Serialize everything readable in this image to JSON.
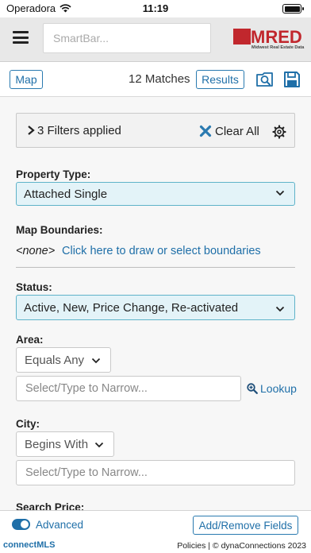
{
  "status_bar": {
    "carrier": "Operadora",
    "time": "11:19"
  },
  "header": {
    "search_placeholder": "SmartBar...",
    "logo_word": "MRED",
    "logo_tagline": "Midwest Real Estate Data"
  },
  "toolbar": {
    "map_label": "Map",
    "matches_text": "12 Matches",
    "results_label": "Results"
  },
  "filters": {
    "summary": "3 Filters applied",
    "clear_label": "Clear All"
  },
  "property_type": {
    "label": "Property Type:",
    "value": "Attached Single"
  },
  "map_boundaries": {
    "label": "Map Boundaries:",
    "none_text": "<none>",
    "link_text": "Click here to draw or select boundaries"
  },
  "status": {
    "label": "Status:",
    "value": "Active, New, Price Change, Re-activated"
  },
  "area": {
    "label": "Area:",
    "operator": "Equals Any",
    "input_placeholder": "Select/Type to Narrow...",
    "lookup_label": "Lookup"
  },
  "city": {
    "label": "City:",
    "operator": "Begins With",
    "input_placeholder": "Select/Type to Narrow..."
  },
  "search_price": {
    "label": "Search Price:"
  },
  "bottom": {
    "advanced_label": "Advanced",
    "add_remove_label": "Add/Remove Fields"
  },
  "footer": {
    "brand_prefix": "connect",
    "brand_suffix": "MLS",
    "links": "Policies | © dynaConnections 2023"
  },
  "colors": {
    "accent": "#1f6fa8",
    "brand_red": "#c1272d",
    "select_bg": "#e3f3f8",
    "select_border": "#5fb3c9"
  }
}
